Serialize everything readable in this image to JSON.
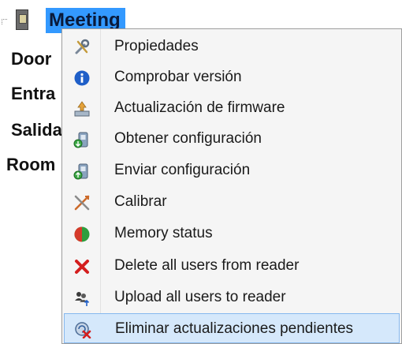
{
  "tree": {
    "selected_label": "Meeting",
    "items": [
      "Door",
      "Entra",
      "Salida",
      "Room"
    ]
  },
  "context_menu": {
    "items": [
      {
        "label": "Propiedades",
        "icon": "tools-icon"
      },
      {
        "label": "Comprobar versión",
        "icon": "info-icon"
      },
      {
        "label": "Actualización de firmware",
        "icon": "firmware-update-icon"
      },
      {
        "label": "Obtener configuración",
        "icon": "get-config-icon"
      },
      {
        "label": "Enviar configuración",
        "icon": "send-config-icon"
      },
      {
        "label": "Calibrar",
        "icon": "calibrate-icon"
      },
      {
        "label": "Memory status",
        "icon": "memory-status-icon"
      },
      {
        "label": "Delete all users from reader",
        "icon": "delete-x-icon"
      },
      {
        "label": "Upload all users to reader",
        "icon": "users-upload-icon"
      },
      {
        "label": "Eliminar actualizaciones pendientes",
        "icon": "remove-pending-updates-icon",
        "highlighted": true
      }
    ]
  },
  "colors": {
    "selection": "#3399ff",
    "highlight": "#d5e8fb"
  }
}
